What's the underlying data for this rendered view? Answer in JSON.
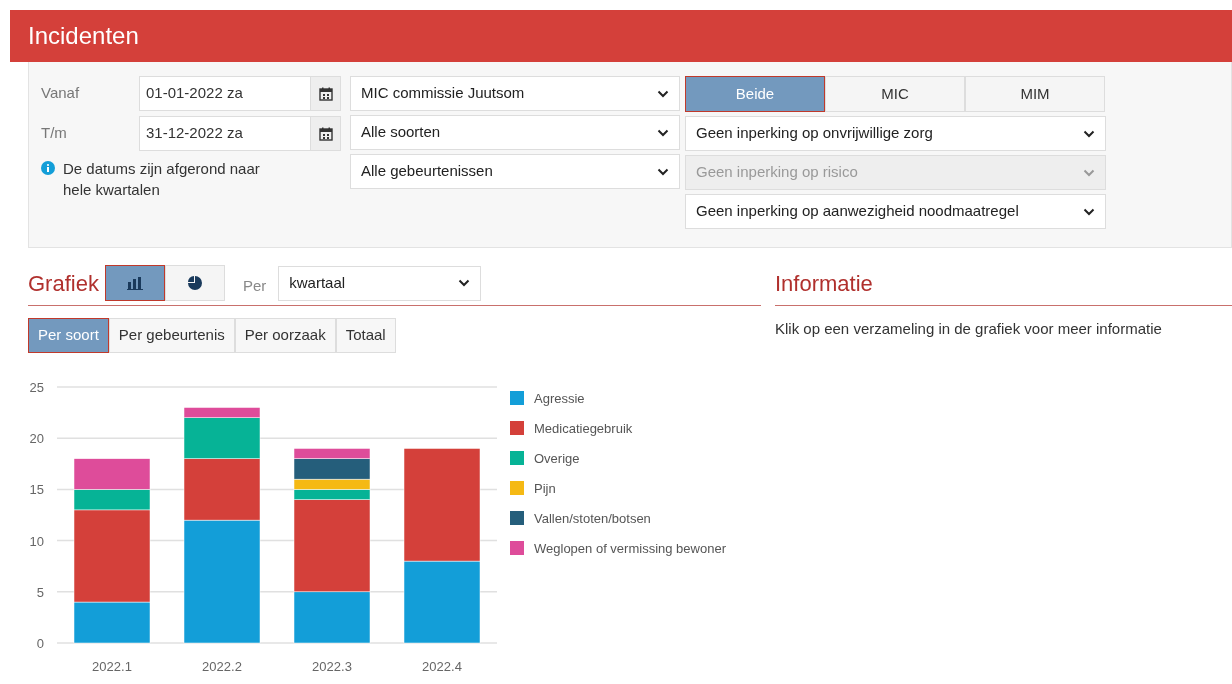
{
  "header": {
    "title": "Incidenten"
  },
  "filters": {
    "date_from": {
      "label": "Vanaf",
      "value": "01-01-2022 za"
    },
    "date_to": {
      "label": "T/m",
      "value": "31-12-2022 za"
    },
    "note": "De datums zijn afgerond naar hele kwartalen",
    "middle_selects": [
      {
        "value": "MIC commissie Juutsom",
        "disabled": false
      },
      {
        "value": "Alle soorten",
        "disabled": false
      },
      {
        "value": "Alle gebeurtenissen",
        "disabled": false
      }
    ],
    "scope_toggle": [
      {
        "label": "Beide",
        "selected": true
      },
      {
        "label": "MIC",
        "selected": false
      },
      {
        "label": "MIM",
        "selected": false
      }
    ],
    "right_selects": [
      {
        "value": "Geen inperking op onvrijwillige zorg",
        "disabled": false
      },
      {
        "value": "Geen inperking op risico",
        "disabled": true
      },
      {
        "value": "Geen inperking op aanwezigheid noodmaatregel",
        "disabled": false
      }
    ]
  },
  "chart_panel": {
    "title": "Grafiek",
    "chart_types": [
      {
        "kind": "bar",
        "selected": true
      },
      {
        "kind": "pie",
        "selected": false
      }
    ],
    "per_label": "Per",
    "per_value": "kwartaal",
    "tabs": [
      {
        "label": "Per soort",
        "selected": true
      },
      {
        "label": "Per gebeurtenis",
        "selected": false
      },
      {
        "label": "Per oorzaak",
        "selected": false
      },
      {
        "label": "Totaal",
        "selected": false
      }
    ],
    "chart_data": {
      "type": "bar",
      "stacked": true,
      "grid": true,
      "legend": true,
      "categories": [
        "2022.1",
        "2022.2",
        "2022.3",
        "2022.4"
      ],
      "ylim": [
        0,
        25
      ],
      "yticks": [
        0,
        5,
        10,
        15,
        20,
        25
      ],
      "series": [
        {
          "name": "Agressie",
          "color": "#139ed8",
          "values": [
            4,
            12,
            5,
            8
          ]
        },
        {
          "name": "Medicatiegebruik",
          "color": "#d4403a",
          "values": [
            9,
            6,
            9,
            11
          ]
        },
        {
          "name": "Overige",
          "color": "#06b396",
          "values": [
            2,
            4,
            1,
            0
          ]
        },
        {
          "name": "Pijn",
          "color": "#f5b914",
          "values": [
            0,
            0,
            1,
            0
          ]
        },
        {
          "name": "Vallen/stoten/botsen",
          "color": "#255e7b",
          "values": [
            0,
            0,
            2,
            0
          ]
        },
        {
          "name": "Weglopen of vermissing bewoner",
          "color": "#de4c9a",
          "values": [
            3,
            1,
            1,
            0
          ]
        }
      ]
    }
  },
  "info_panel": {
    "title": "Informatie",
    "text": "Klik op een verzameling in de grafiek voor meer informatie"
  }
}
